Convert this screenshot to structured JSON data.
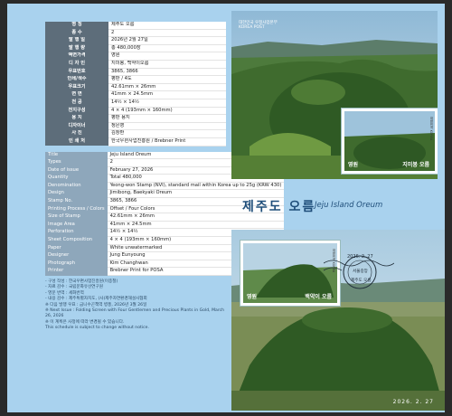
{
  "header": {
    "logo_text": "대한민국 우정사업본부",
    "logo_sub": "KOREA POST"
  },
  "kr_table": [
    {
      "label": "명 칭",
      "value": "제주도 오름"
    },
    {
      "label": "종 수",
      "value": "2"
    },
    {
      "label": "발 행 일",
      "value": "2026년 2월 27일"
    },
    {
      "label": "발 행 량",
      "value": "총 480,000장"
    },
    {
      "label": "액면가격",
      "value": "영원"
    },
    {
      "label": "디 자 인",
      "value": "지미봉, 백약이오름"
    },
    {
      "label": "우표번호",
      "value": "3865, 3866"
    },
    {
      "label": "인쇄/색수",
      "value": "평판 / 4도"
    },
    {
      "label": "우표크기",
      "value": "42.61mm × 26mm"
    },
    {
      "label": "면 면",
      "value": "41mm × 24.5mm"
    },
    {
      "label": "천 공",
      "value": "14½ × 14½"
    },
    {
      "label": "전지구성",
      "value": "4 × 4 (193mm × 160mm)"
    },
    {
      "label": "용 지",
      "value": "평판 용지"
    },
    {
      "label": "디자이너",
      "value": "정은영"
    },
    {
      "label": "사 진",
      "value": "김창환"
    },
    {
      "label": "인 쇄 처",
      "value": "한국우편사업진흥원 / Brebner Print"
    }
  ],
  "en_table": [
    {
      "label": "Title",
      "value": "Jeju Island Oreum"
    },
    {
      "label": "Types",
      "value": "2"
    },
    {
      "label": "Date of issue",
      "value": "February 27, 2026"
    },
    {
      "label": "Quantity",
      "value": "Total 480,000"
    },
    {
      "label": "Denomination",
      "value": "Yeong-won Stamp (NVI), standard mail within Korea up to 25g (KRW 430)"
    },
    {
      "label": "Design",
      "value": "Jimibong, Baekyaki Oreum"
    },
    {
      "label": "Stamp No.",
      "value": "3865, 3866"
    },
    {
      "label": "Printing Process / Colors",
      "value": "Offset / Four Colors"
    },
    {
      "label": "Size of Stamp",
      "value": "42.61mm × 26mm"
    },
    {
      "label": "Image Area",
      "value": "41mm × 24.5mm"
    },
    {
      "label": "Perforation",
      "value": "14½ × 14½"
    },
    {
      "label": "Sheet Composition",
      "value": "4 × 4 (193mm × 160mm)"
    },
    {
      "label": "Paper",
      "value": "White unwatermarked"
    },
    {
      "label": "Designer",
      "value": "Jung Eunyoung"
    },
    {
      "label": "Photograph",
      "value": "Kim Changhwan"
    },
    {
      "label": "Printer",
      "value": "Brebner Print for POSA"
    }
  ],
  "notes": [
    "- 구성 작성 : 한국우편사업진흥원(이종철)",
    "- 자료 감수 : 국립문화유산연구원",
    "- 영문 번역 : 세화번역",
    "- 내용 감수 : 제주특별자치도, (사)제주자연환경해설사협회",
    "※ 다음 발행 우표 : 금니수곤책역 병풍, 2026년 3월 26일",
    "※ Next Issue : Folding Screen with Four Gentlemen and Precious Plants in Gold, March 26, 2026",
    "※ 이 계획은 사정에 따라 변경될 수 있습니다.",
    "This schedule is subject to change without notice."
  ],
  "title": {
    "kr": "제주도 오름",
    "en": "Jeju Island Oreum"
  },
  "stamp_top": {
    "value": "영원",
    "name": "지미봉 오름",
    "side": "대한민국 KOREA"
  },
  "stamp_bottom": {
    "value": "영원",
    "name": "백약이 오름",
    "side": "대한민국 KOREA"
  },
  "postmark": {
    "date": "2026. 2. 27",
    "place": "서울중앙",
    "name": "제주도 오름"
  },
  "photo_date": "2026. 2. 27",
  "colors": {
    "sheet_bg": "#a9d2ee",
    "kr_label": "#5d6d7a",
    "en_label": "#8ea7bb",
    "accent": "#1f4e7a"
  }
}
